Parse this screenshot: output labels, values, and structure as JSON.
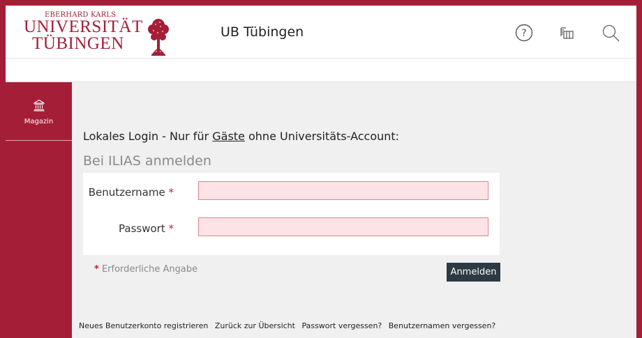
{
  "header": {
    "logo": {
      "line_small": "EBERHARD KARLS",
      "line1": "UNIVERSITÄT",
      "line2": "TÜBINGEN"
    },
    "site_title": "UB Tübingen",
    "icons": [
      "help-icon",
      "library-catalog-icon",
      "search-icon"
    ]
  },
  "sidebar": {
    "items": [
      {
        "label": "Magazin",
        "icon": "bank-icon"
      }
    ]
  },
  "login": {
    "intro_prefix": "Lokales Login - Nur für ",
    "intro_link": "Gäste",
    "intro_suffix": " ohne Universitäts-Account:",
    "form_title": "Bei ILIAS anmelden",
    "username_label": "Benutzername",
    "username_value": "",
    "password_label": "Passwort",
    "password_value": "",
    "required_marker": "*",
    "required_note": "Erforderliche Angabe",
    "submit_label": "Anmelden"
  },
  "footer": {
    "links": [
      "Neues Benutzerkonto registrieren",
      "Zurück zur Übersicht",
      "Passwort vergessen?",
      "Benutzernamen vergessen?"
    ]
  },
  "colors": {
    "brand": "#a51e37",
    "button": "#2c3a43",
    "input_bg": "#fde3e6",
    "input_border": "#d9848f"
  }
}
